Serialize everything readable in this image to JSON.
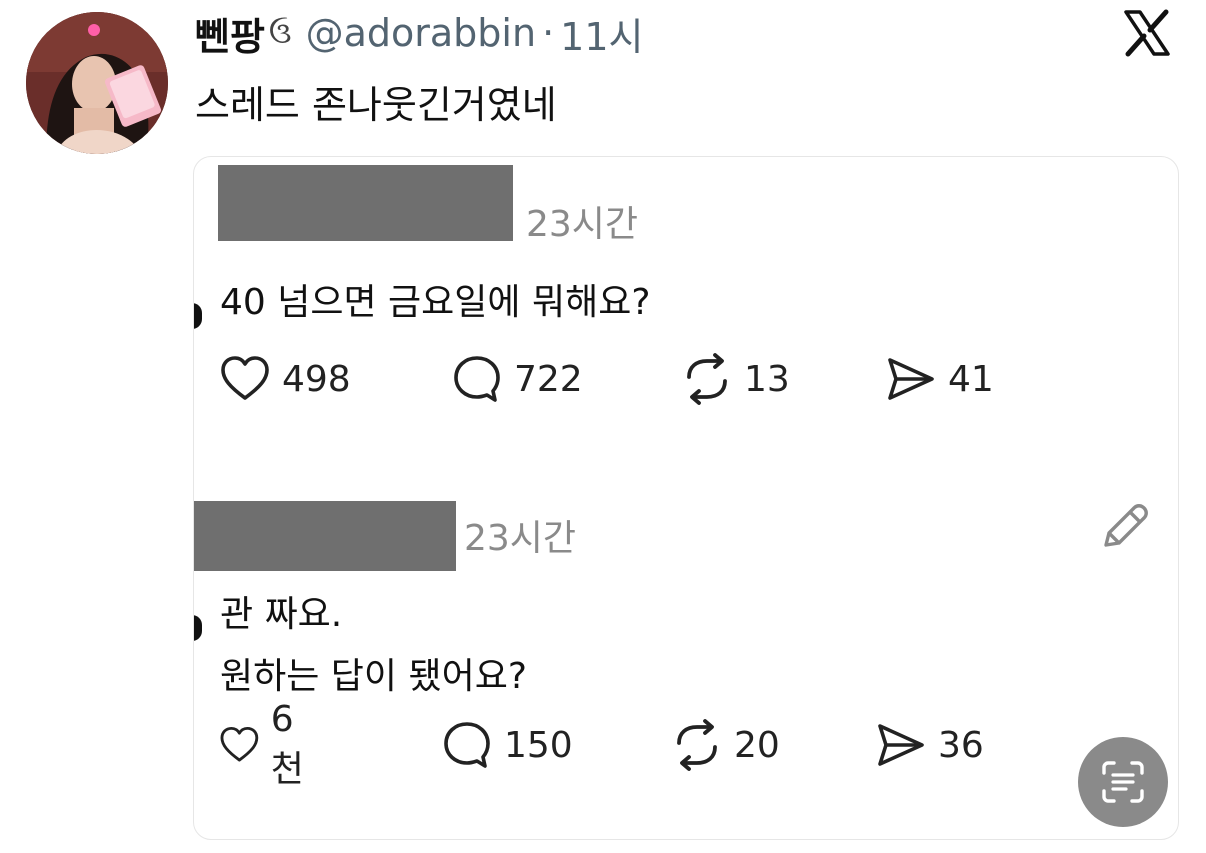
{
  "tweet": {
    "display_name": "뻰팡",
    "name_emoji": "ઉ",
    "handle": "@adorabbin",
    "separator": "·",
    "time": "11시",
    "text": "스레드 존나웃긴거였네",
    "logo_icon": "x-logo-icon",
    "avatar_icon": "profile-avatar"
  },
  "quoted": {
    "post1": {
      "time": "23시간",
      "text": "40 넘으면 금요일에 뭐해요?",
      "likes": "498",
      "replies": "722",
      "reposts": "13",
      "shares": "41"
    },
    "post2": {
      "time": "23시간",
      "line1": "관 짜요.",
      "line2": "원하는 답이 됐어요?",
      "likes": "6천",
      "replies": "150",
      "reposts": "20",
      "shares": "36"
    }
  },
  "icons": {
    "like": "heart-icon",
    "reply": "comment-icon",
    "repost": "repost-icon",
    "share": "send-icon",
    "edit": "pencil-icon",
    "scan": "scan-text-icon"
  },
  "colors": {
    "text": "#111111",
    "muted": "#536471",
    "redaction": "#6f6f6f",
    "scan_button": "#8a8a8a"
  }
}
